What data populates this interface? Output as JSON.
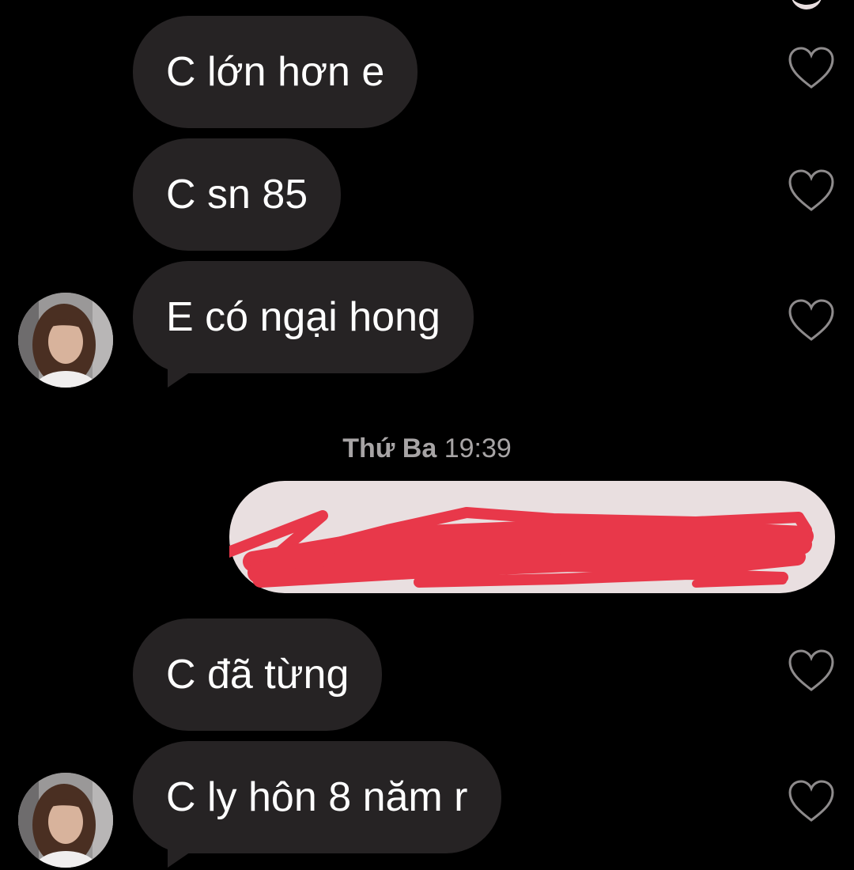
{
  "messages": [
    {
      "side": "incoming",
      "text": "C lớn hơn e",
      "liked": false
    },
    {
      "side": "incoming",
      "text": "C sn 85",
      "liked": false
    },
    {
      "side": "incoming",
      "text": "E có ngại hong",
      "liked": false
    },
    {
      "side": "outgoing",
      "text": "",
      "redacted": true
    },
    {
      "side": "incoming",
      "text": "C đã từng",
      "liked": false
    },
    {
      "side": "incoming",
      "text": "C ly hôn 8 năm r",
      "liked": false
    }
  ],
  "timestamp": {
    "day": "Thứ Ba",
    "time": "19:39"
  },
  "colors": {
    "background": "#000000",
    "incoming_bubble": "#262324",
    "outgoing_bubble": "#e9dfe0",
    "redaction": "#e8384a",
    "heart_outline": "#8e8b8c",
    "timestamp_text": "#a7a4a5"
  },
  "icons": {
    "like": "heart-outline-icon",
    "avatar": "contact-avatar-photo"
  }
}
